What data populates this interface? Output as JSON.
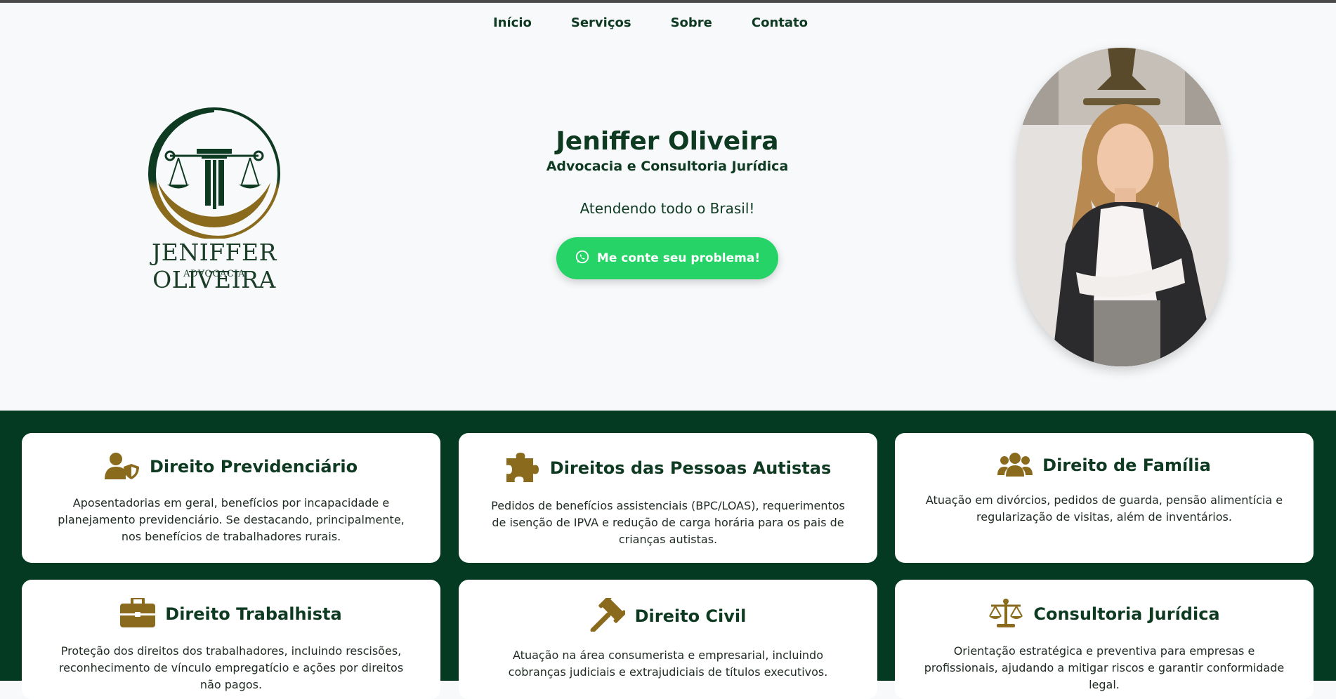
{
  "nav": {
    "items": [
      "Início",
      "Serviços",
      "Sobre",
      "Contato"
    ]
  },
  "logo": {
    "name": "JENIFFER OLIVEIRA",
    "subtitle": "ADVOCACIA"
  },
  "hero": {
    "title": "Jeniffer Oliveira",
    "subtitle": "Advocacia e Consultoria Jurídica",
    "tagline": "Atendendo todo o Brasil!",
    "cta_label": "Me conte seu problema!",
    "cta_icon": "whatsapp-icon"
  },
  "services": [
    {
      "title": "Direito Previdenciário",
      "icon": "user-shield-icon",
      "description": "Aposentadorias em geral, benefícios por incapacidade e planejamento previdenciário. Se destacando, principalmente, nos benefícios de trabalhadores rurais."
    },
    {
      "title": "Direitos das Pessoas Autistas",
      "icon": "puzzle-piece-icon",
      "description": "Pedidos de benefícios assistenciais (BPC/LOAS), requerimentos de isenção de IPVA e redução de carga horária para os pais de crianças autistas."
    },
    {
      "title": "Direito de Família",
      "icon": "users-icon",
      "description": "Atuação em divórcios, pedidos de guarda, pensão alimentícia e regularização de visitas, além de inventários."
    },
    {
      "title": "Direito Trabalhista",
      "icon": "briefcase-icon",
      "description": "Proteção dos direitos dos trabalhadores, incluindo rescisões, reconhecimento de vínculo empregatício e ações por direitos não pagos."
    },
    {
      "title": "Direito Civil",
      "icon": "gavel-icon",
      "description": "Atuação na área consumerista e empresarial, incluindo cobranças judiciais e extrajudiciais de títulos executivos."
    },
    {
      "title": "Consultoria Jurídica",
      "icon": "scale-balanced-icon",
      "description": "Orientação estratégica e preventiva para empresas e profissionais, ajudando a mitigar riscos e garantir conformidade legal."
    }
  ],
  "colors": {
    "brand_green": "#043a21",
    "accent_gold": "#8a6a1c",
    "whatsapp_green": "#25d366"
  }
}
